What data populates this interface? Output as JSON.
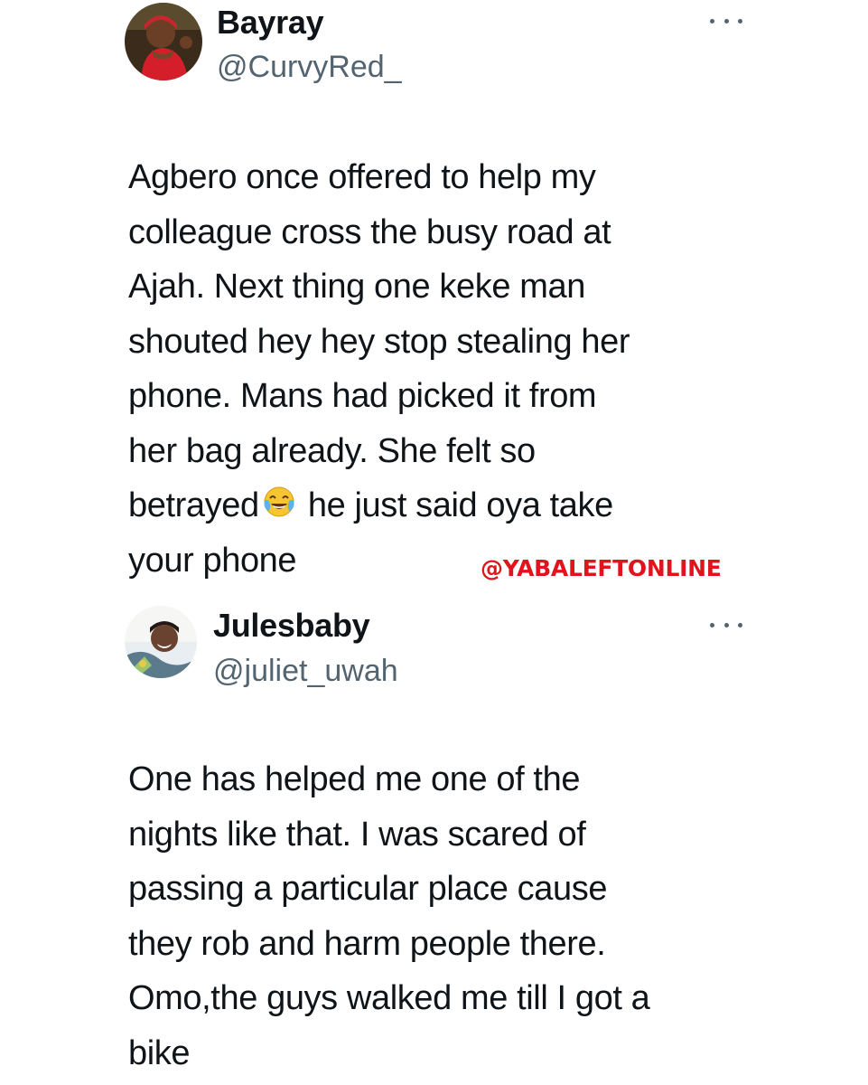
{
  "tweets": [
    {
      "display_name": "Bayray",
      "handle": "@CurvyRed_",
      "more_icon": "more-horizontal-icon",
      "text_before_emoji": "Agbero once offered to help my\ncolleague cross the  busy road at\nAjah. Next thing one keke man\nshouted hey hey stop stealing her\nphone. Mans had picked it from\nher bag already. She felt so\nbetrayed",
      "emoji": "face-with-tears-of-joy",
      "text_after_emoji": " he just said oya take\nyour phone"
    },
    {
      "display_name": "Julesbaby",
      "handle": "@juliet_uwah",
      "more_icon": "more-horizontal-icon",
      "text": "One has helped me one of the\nnights like that. I was scared of\npassing a particular place cause\nthey rob and harm people there.\nOmo,the guys walked me till I got a\nbike"
    }
  ],
  "watermark": "@YABALEFTONLINE",
  "colors": {
    "text": "#0f1419",
    "secondary": "#536471",
    "watermark": "#e0141c"
  }
}
